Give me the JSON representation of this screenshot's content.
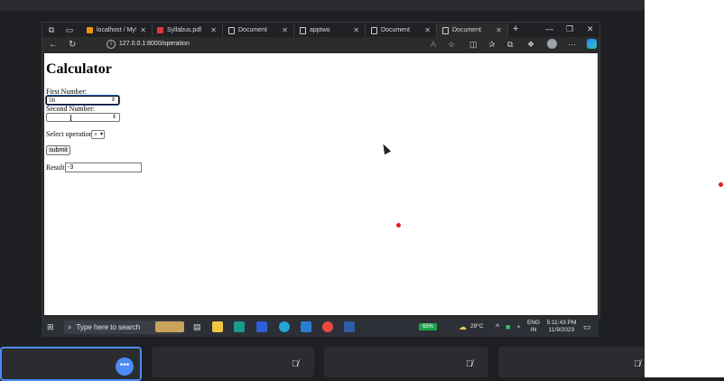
{
  "browser": {
    "tabs": [
      {
        "label": "localhost / MySQL",
        "icon": "mysql-icon",
        "active": false
      },
      {
        "label": "Syllabus.pdf",
        "icon": "pdf-icon",
        "active": false
      },
      {
        "label": "Document",
        "icon": "document-icon",
        "active": false
      },
      {
        "label": "apptwo",
        "icon": "document-icon",
        "active": false
      },
      {
        "label": "Document",
        "icon": "document-icon",
        "active": false
      },
      {
        "label": "Document",
        "icon": "document-icon",
        "active": true
      }
    ],
    "new_tab": "+",
    "url": "127.0.0.1:8000/operation",
    "window_controls": {
      "minimize": "—",
      "restore": "❐",
      "close": "✕"
    }
  },
  "page": {
    "title": "Calculator",
    "first_label": "First Number:",
    "first_value": "56",
    "second_label": "Second Number:",
    "second_value": "",
    "op_label": "Select operation",
    "op_value": "+",
    "submit": "submit",
    "result_label": "Result",
    "result_value": "-3"
  },
  "taskbar": {
    "search_placeholder": "Type here to search",
    "battery": "65%",
    "temperature": "29°C",
    "lang": "ENG",
    "region": "IN",
    "time": "5:11:43 PM",
    "date": "11/9/2023"
  },
  "colors": {
    "accent": "#4c8bf5",
    "battery": "#1aa34a",
    "dot": "#e21b1b"
  }
}
